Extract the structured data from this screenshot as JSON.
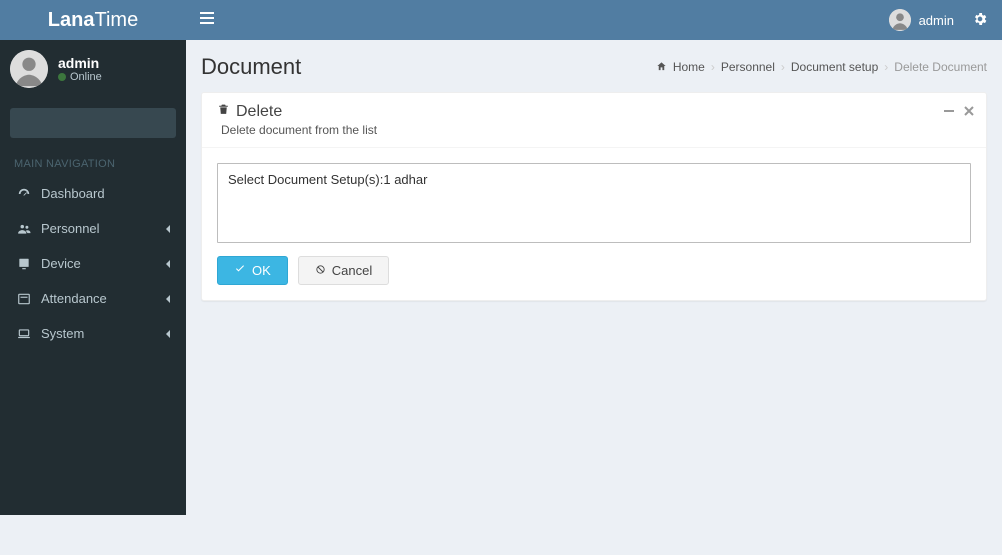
{
  "brand": {
    "part1": "Lana",
    "part2": "Time"
  },
  "header_user": "admin",
  "sidebar_user": {
    "name": "admin",
    "status": "Online"
  },
  "nav_header": "MAIN NAVIGATION",
  "nav": [
    {
      "label": "Dashboard",
      "icon": "dashboard-icon",
      "expandable": false
    },
    {
      "label": "Personnel",
      "icon": "users-icon",
      "expandable": true
    },
    {
      "label": "Device",
      "icon": "device-icon",
      "expandable": true
    },
    {
      "label": "Attendance",
      "icon": "attendance-icon",
      "expandable": true
    },
    {
      "label": "System",
      "icon": "laptop-icon",
      "expandable": true
    }
  ],
  "page": {
    "title": "Document"
  },
  "breadcrumb": [
    {
      "label": "Home",
      "link": true
    },
    {
      "label": "Personnel",
      "link": true
    },
    {
      "label": "Document setup",
      "link": true
    },
    {
      "label": "Delete Document",
      "link": false
    }
  ],
  "panel": {
    "title": "Delete",
    "subtitle": "Delete document from the list",
    "body_text": "Select Document Setup(s):1 adhar",
    "ok_label": "OK",
    "cancel_label": "Cancel"
  }
}
